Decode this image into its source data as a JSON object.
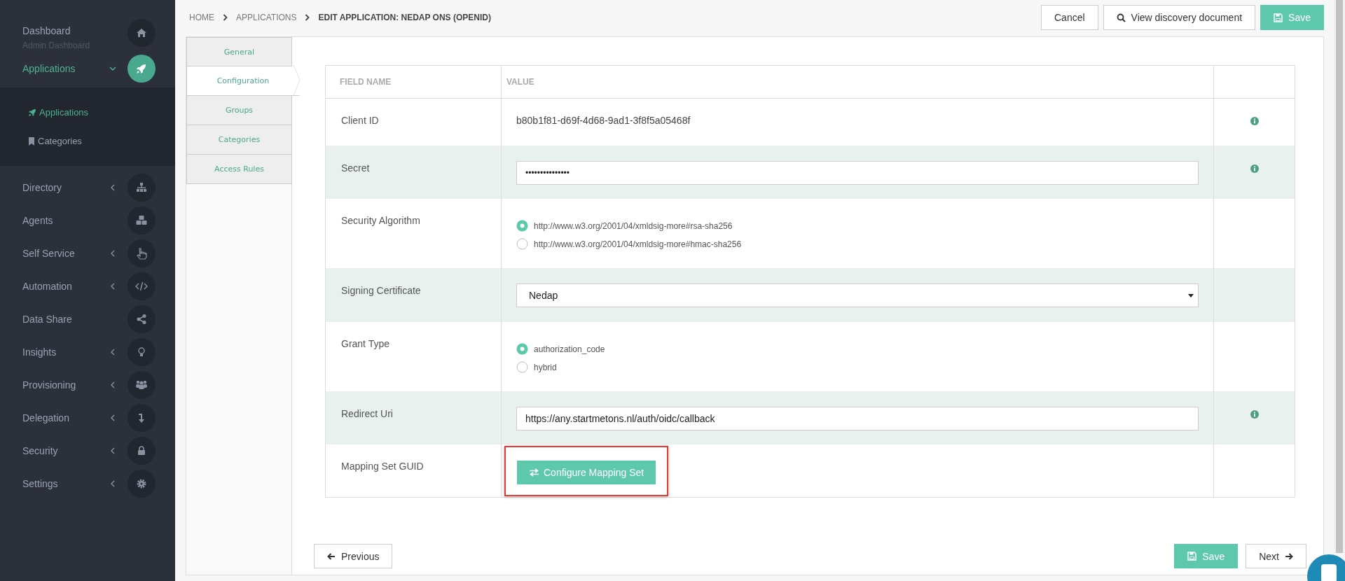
{
  "sidebar": {
    "items": [
      {
        "label": "Dashboard",
        "subtitle": "Admin Dashboard",
        "kind": "link",
        "selected": false
      },
      {
        "label": "Applications",
        "kind": "group",
        "expanded": true,
        "selected": true,
        "children": [
          {
            "label": "Applications",
            "selected": true
          },
          {
            "label": "Categories",
            "selected": false
          }
        ]
      },
      {
        "label": "Directory",
        "kind": "group",
        "expanded": false,
        "selected": false
      },
      {
        "label": "Agents",
        "kind": "link",
        "selected": false
      },
      {
        "label": "Self Service",
        "kind": "group",
        "expanded": false,
        "selected": false
      },
      {
        "label": "Automation",
        "kind": "group",
        "expanded": false,
        "selected": false
      },
      {
        "label": "Data Share",
        "kind": "link",
        "selected": false
      },
      {
        "label": "Insights",
        "kind": "group",
        "expanded": false,
        "selected": false
      },
      {
        "label": "Provisioning",
        "kind": "group",
        "expanded": false,
        "selected": false
      },
      {
        "label": "Delegation",
        "kind": "group",
        "expanded": false,
        "selected": false
      },
      {
        "label": "Security",
        "kind": "group",
        "expanded": false,
        "selected": false
      },
      {
        "label": "Settings",
        "kind": "group",
        "expanded": false,
        "selected": false
      }
    ]
  },
  "breadcrumb": [
    "HOME",
    "APPLICATIONS",
    "EDIT APPLICATION: NEDAP ONS (OPENID)"
  ],
  "header_buttons": [
    {
      "label": "Cancel",
      "kind": "plain"
    },
    {
      "label": "View discovery document",
      "kind": "search"
    },
    {
      "label": "Save",
      "kind": "save"
    }
  ],
  "tabs": [
    {
      "label": "General",
      "selected": false
    },
    {
      "label": "Configuration",
      "selected": true
    },
    {
      "label": "Groups",
      "selected": false
    },
    {
      "label": "Categories",
      "selected": false
    },
    {
      "label": "Access Rules",
      "selected": false
    }
  ],
  "table": {
    "columns": [
      "FIELD NAME",
      "VALUE"
    ],
    "rows": [
      {
        "name": "Client ID",
        "kind": "text",
        "value": "b80b1f81-d69f-4d68-9ad1-3f8f5a05468f",
        "info": true,
        "shaded": false
      },
      {
        "name": "Secret",
        "kind": "password",
        "value": "•••••••••••••••",
        "info": true,
        "shaded": true
      },
      {
        "name": "Security Algorithm",
        "kind": "radio",
        "options": [
          {
            "label": "http://www.w3.org/2001/04/xmldsig-more#rsa-sha256",
            "selected": true
          },
          {
            "label": "http://www.w3.org/2001/04/xmldsig-more#hmac-sha256",
            "selected": false
          }
        ],
        "info": false,
        "shaded": false
      },
      {
        "name": "Signing Certificate",
        "kind": "select",
        "value": "Nedap",
        "info": false,
        "shaded": true
      },
      {
        "name": "Grant Type",
        "kind": "radio",
        "options": [
          {
            "label": "authorization_code",
            "selected": true
          },
          {
            "label": "hybrid",
            "selected": false
          }
        ],
        "info": false,
        "shaded": false
      },
      {
        "name": "Redirect Uri",
        "kind": "input",
        "value": "https://any.startmetons.nl/auth/oidc/callback",
        "info": true,
        "shaded": true
      },
      {
        "name": "Mapping Set GUID",
        "kind": "button",
        "button": "Configure Mapping Set",
        "highlighted": true,
        "info": false,
        "shaded": false
      }
    ]
  },
  "footer_buttons": [
    {
      "label": "Previous",
      "kind": "previous"
    },
    {
      "label": "Save",
      "kind": "save"
    },
    {
      "label": "Next",
      "kind": "next"
    }
  ]
}
